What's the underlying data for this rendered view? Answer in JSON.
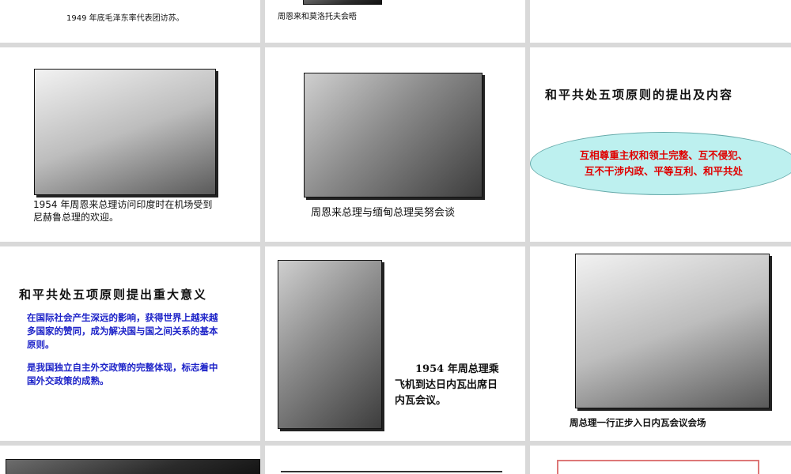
{
  "slides": {
    "r0c0": {
      "caption": "1949 年底毛泽东率代表团访苏。"
    },
    "r0c1": {
      "caption": "周恩来和莫洛托夫会晤"
    },
    "r1c0": {
      "caption": "1954 年周恩来总理访问印度时在机场受到尼赫鲁总理的欢迎。"
    },
    "r1c1": {
      "caption": "周恩来总理与缅甸总理吴努会谈"
    },
    "r1c2": {
      "title": "和平共处五项原则的提出及内容",
      "principles": "互相尊重主权和领土完整、互不侵犯、\n互不干涉内政、平等互利、和平共处"
    },
    "r2c0": {
      "title": "和平共处五项原则提出重大意义",
      "point1": "在国际社会产生深远的影响，获得世界上越来越多国家的赞同，成为解决国与国之间关系的基本原则。",
      "point2": "是我国独立自主外交政策的完整体现，标志着中国外交政策的成熟。"
    },
    "r2c1": {
      "caption": "1954 年周总理乘飞机到达日内瓦出席日内瓦会议。"
    },
    "r2c2": {
      "caption": "周总理一行正步入日内瓦会议会场"
    }
  },
  "icons": [
    "photo-mao-delegation",
    "photo-zhou-molotov",
    "photo-zhou-nehru",
    "photo-zhou-u-nu",
    "photo-zhou-airplane",
    "photo-geneva-walk"
  ]
}
